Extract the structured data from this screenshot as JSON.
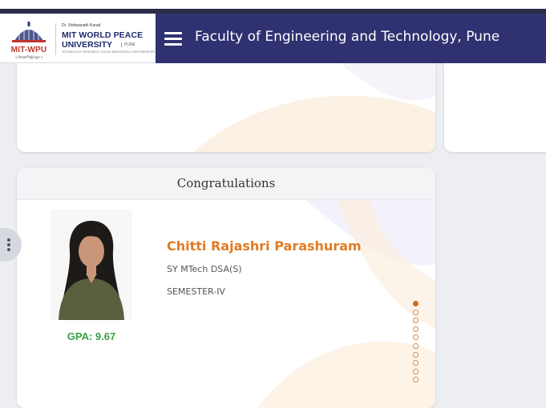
{
  "header": {
    "title": "Faculty of Engineering and Technology, Pune",
    "menu_icon": "hamburger-menu-icon"
  },
  "logo": {
    "left_text": "MIT-WPU",
    "tagline": "॥ विश्वशान्तिर्ध्रुवं ध्रुवा ॥",
    "small_line": "Dr. Vishwanath Karad",
    "name_line1": "MIT WORLD PEACE",
    "name_line2": "UNIVERSITY",
    "city": "PUNE",
    "subtitle": "TECHNOLOGY, RESEARCH, SOCIAL INNOVATION & PARTNERSHIPS"
  },
  "congrats_card": {
    "title": "Congratulations",
    "student": {
      "name": "Chitti Rajashri Parashuram",
      "program": "SY MTech DSA(S)",
      "semester": "SEMESTER-IV",
      "gpa": "GPA: 9.67"
    },
    "carousel": {
      "total": 10,
      "active_index": 0
    }
  },
  "colors": {
    "header_bg": "#2f3170",
    "name_orange": "#e17b23",
    "gpa_green": "#3aa04a",
    "active_dot": "#d06d1e"
  }
}
